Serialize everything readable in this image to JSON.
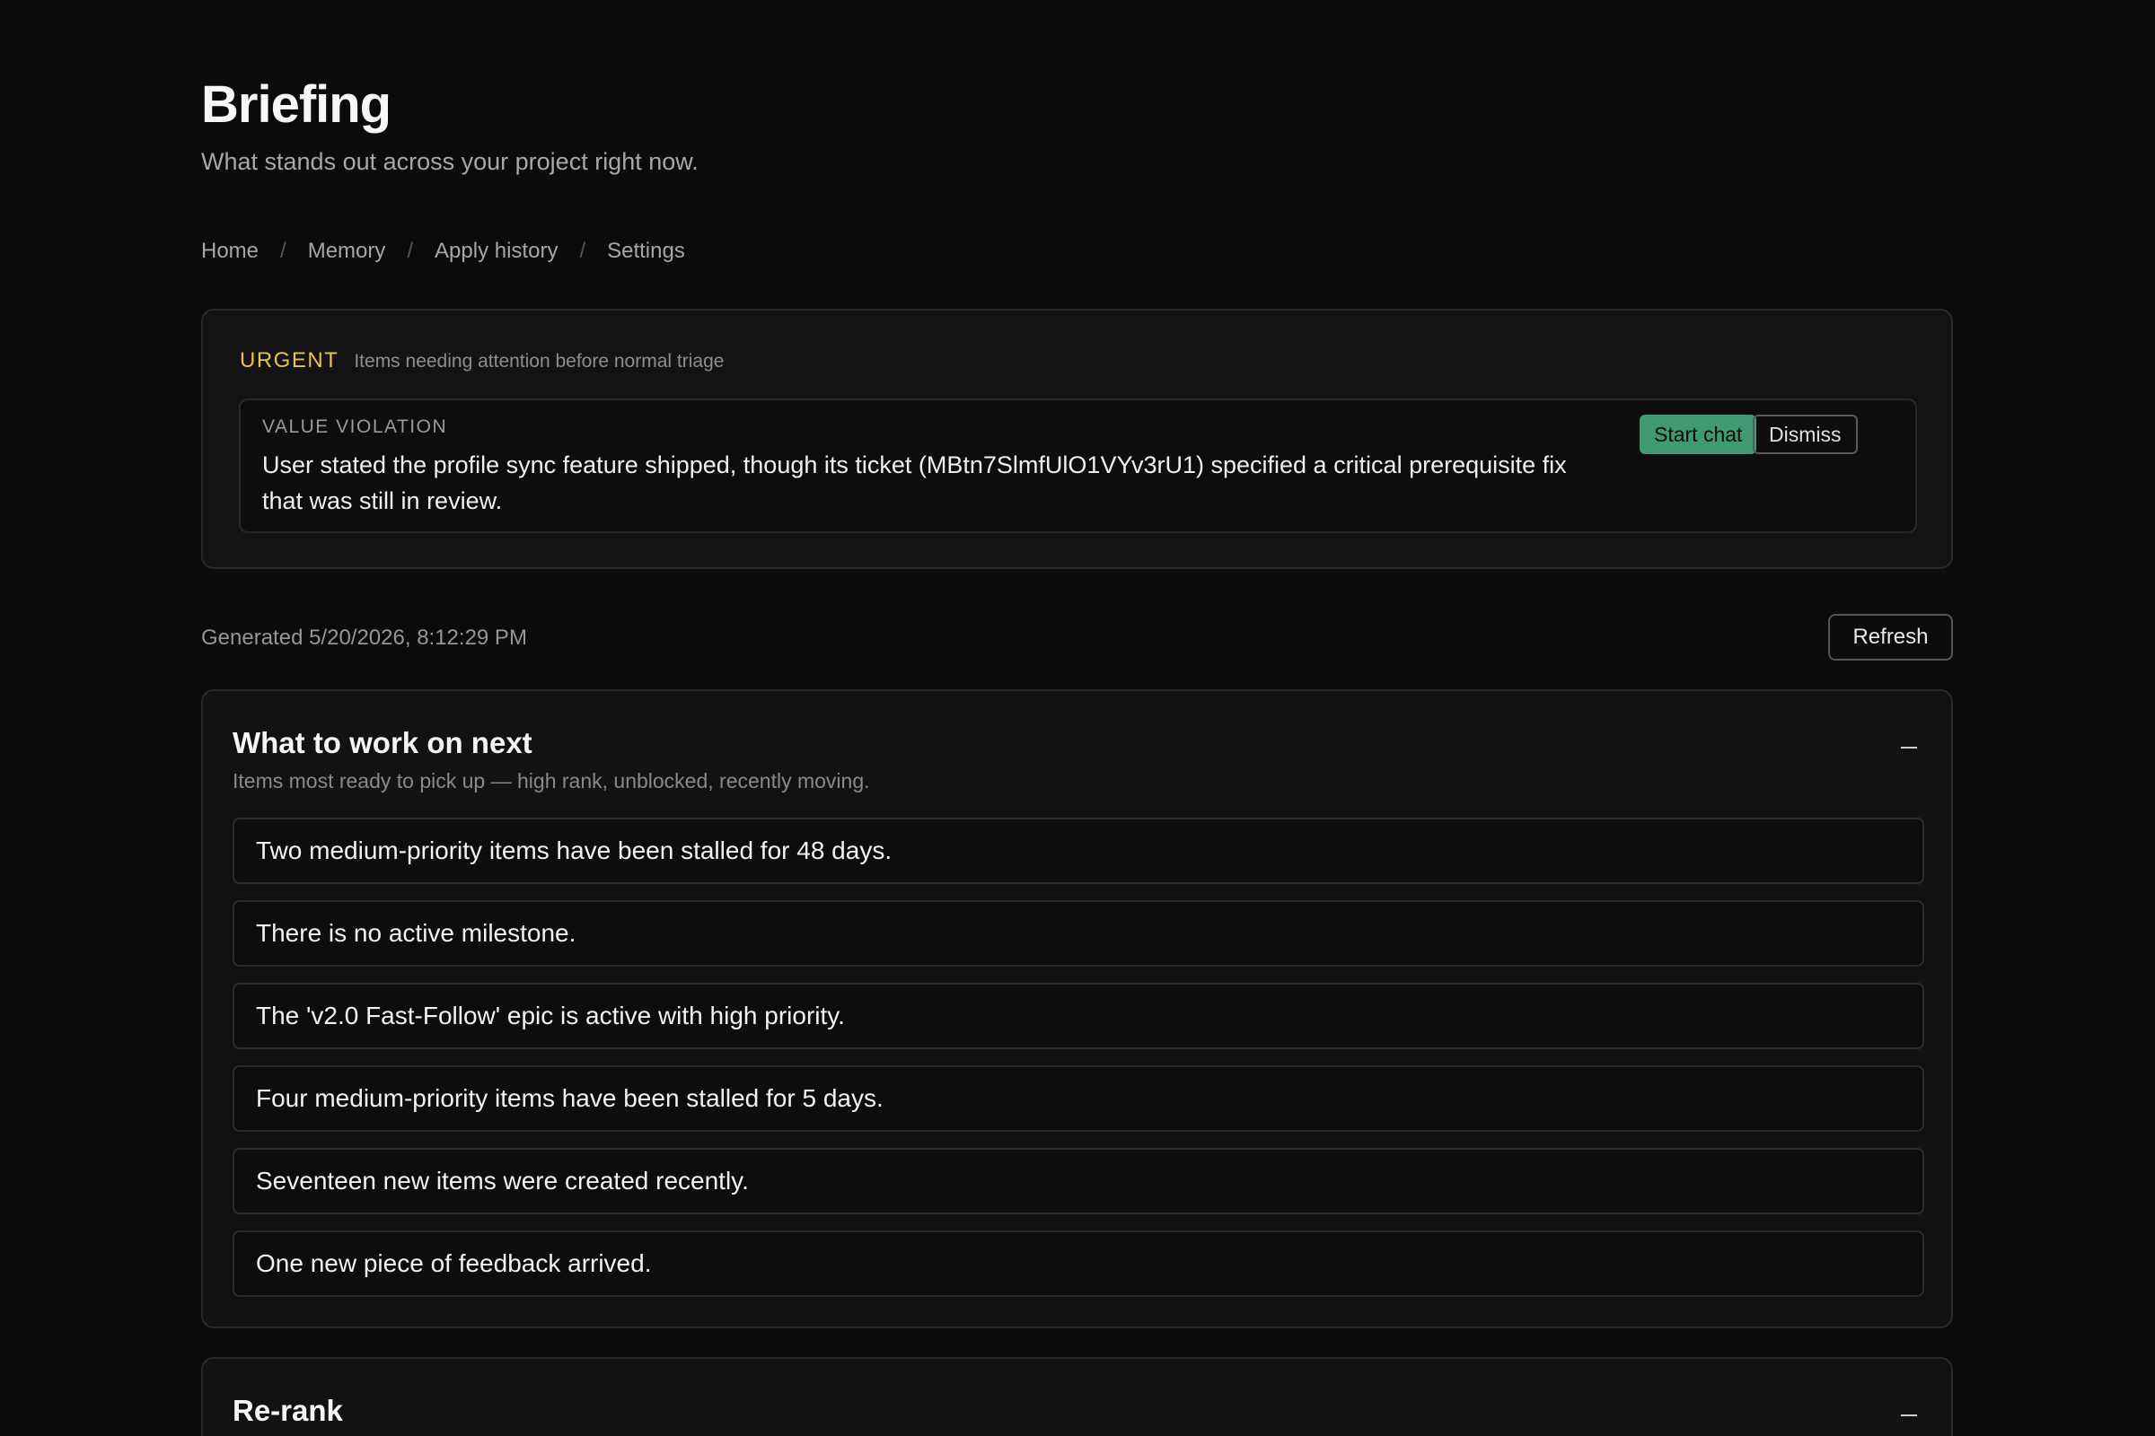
{
  "header": {
    "title": "Briefing",
    "subtitle": "What stands out across your project right now."
  },
  "nav": {
    "items": [
      "Home",
      "Memory",
      "Apply history",
      "Settings"
    ],
    "separator": "/"
  },
  "urgent": {
    "tag": "URGENT",
    "description": "Items needing attention before normal triage",
    "violation": {
      "label": "VALUE VIOLATION",
      "text": "User stated the profile sync feature shipped, though its ticket (MBtn7SlmfUlO1VYv3rU1) specified a critical prerequisite fix that was still in review.",
      "start_chat_label": "Start chat",
      "dismiss_label": "Dismiss"
    }
  },
  "status": {
    "generated": "Generated 5/20/2026, 8:12:29 PM",
    "refresh_label": "Refresh"
  },
  "sections": {
    "next": {
      "title": "What to work on next",
      "description": "Items most ready to pick up — high rank, unblocked, recently moving.",
      "items": [
        "Two medium-priority items have been stalled for 48 days.",
        "There is no active milestone.",
        "The 'v2.0 Fast-Follow' epic is active with high priority.",
        "Four medium-priority items have been stalled for 5 days.",
        "Seventeen new items were created recently.",
        "One new piece of feedback arrived."
      ]
    },
    "rerank": {
      "title": "Re-rank"
    }
  },
  "colors": {
    "background": "#0b0b0b",
    "urgent_accent": "#e6c44d",
    "start_chat_bg": "#3f9a72"
  }
}
